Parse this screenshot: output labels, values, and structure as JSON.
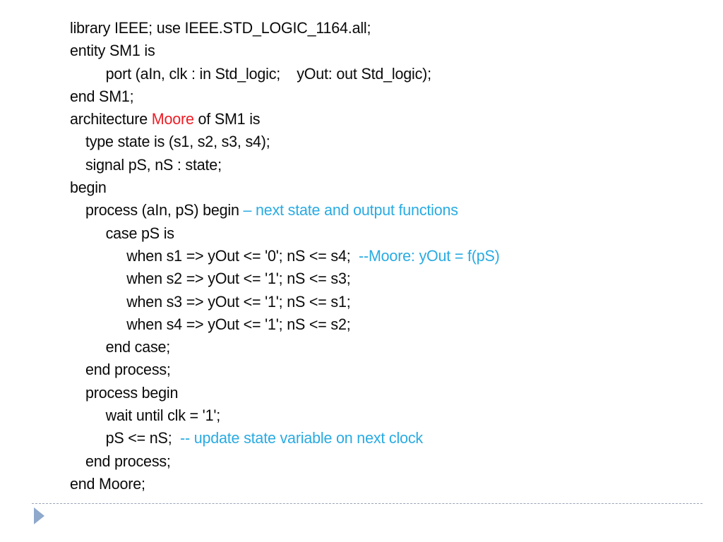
{
  "slide": {
    "background_color": "#ffffff",
    "text_color": "#0a0a0a",
    "accent_red": "#ee1c24",
    "comment_cyan": "#29abe2",
    "divider_color": "#9aa5b8",
    "triangle_color": "#8fa9cc"
  },
  "code": {
    "language": "VHDL",
    "lines": [
      {
        "indent": 0,
        "text": "library IEEE; use IEEE.STD_LOGIC_1164.all;"
      },
      {
        "indent": 0,
        "text": "entity SM1 is"
      },
      {
        "indent": 3,
        "text": "port (aIn, clk : in Std_logic;    yOut: out Std_logic);"
      },
      {
        "indent": 0,
        "text": "end SM1;"
      },
      {
        "indent": 0,
        "text": "architecture ",
        "red": "Moore",
        "after": " of SM1 is"
      },
      {
        "indent": 1,
        "text": "type state is (s1, s2, s3, s4);"
      },
      {
        "indent": 1,
        "text": "signal pS, nS : state;"
      },
      {
        "indent": 0,
        "text": "begin"
      },
      {
        "indent": 1,
        "text": "process (aIn, pS) begin ",
        "comment": "– next state and output functions"
      },
      {
        "indent": 3,
        "text": "case pS is"
      },
      {
        "indent": 4,
        "text": "when s1 => yOut <= '0'; nS <= s4;  ",
        "comment": "--Moore: yOut = f(pS)"
      },
      {
        "indent": 4,
        "text": "when s2 => yOut <= '1'; nS <= s3;"
      },
      {
        "indent": 4,
        "text": "when s3 => yOut <= '1'; nS <= s1;"
      },
      {
        "indent": 4,
        "text": "when s4 => yOut <= '1'; nS <= s2;"
      },
      {
        "indent": 3,
        "text": "end case;"
      },
      {
        "indent": 1,
        "text": "end process;"
      },
      {
        "indent": 1,
        "text": "process begin"
      },
      {
        "indent": 3,
        "text": "wait until clk = '1';"
      },
      {
        "indent": 3,
        "text": "pS <= nS;  ",
        "comment": "-- update state variable on next clock"
      },
      {
        "indent": 1,
        "text": "end process;"
      },
      {
        "indent": 0,
        "text": "end Moore;"
      }
    ],
    "line_01": "library IEEE; use IEEE.STD_LOGIC_1164.all;",
    "line_02": "entity SM1 is",
    "line_03": "port (aIn, clk : in Std_logic;    yOut: out Std_logic);",
    "line_04": "end SM1;",
    "line_05_pre": "architecture ",
    "line_05_red": "Moore",
    "line_05_post": " of SM1 is",
    "line_06": "type state is (s1, s2, s3, s4);",
    "line_07": "signal pS, nS : state;",
    "line_08": "begin",
    "line_09_code": "process (aIn, pS) begin ",
    "line_09_comment": "– next state and output functions",
    "line_10": "case pS is",
    "line_11_code": "when s1 => yOut <= '0'; nS <= s4;  ",
    "line_11_comment": "--Moore: yOut = f(pS)",
    "line_12": "when s2 => yOut <= '1'; nS <= s3;",
    "line_13": "when s3 => yOut <= '1'; nS <= s1;",
    "line_14": "when s4 => yOut <= '1'; nS <= s2;",
    "line_15": "end case;",
    "line_16": "end process;",
    "line_17": "process begin",
    "line_18": "wait until clk = '1';",
    "line_19_code": "pS <= nS;  ",
    "line_19_comment": "-- update state variable on next clock",
    "line_20": "end process;",
    "line_21": "end Moore;"
  },
  "footer": {
    "advance_icon": "play-triangle-icon"
  }
}
